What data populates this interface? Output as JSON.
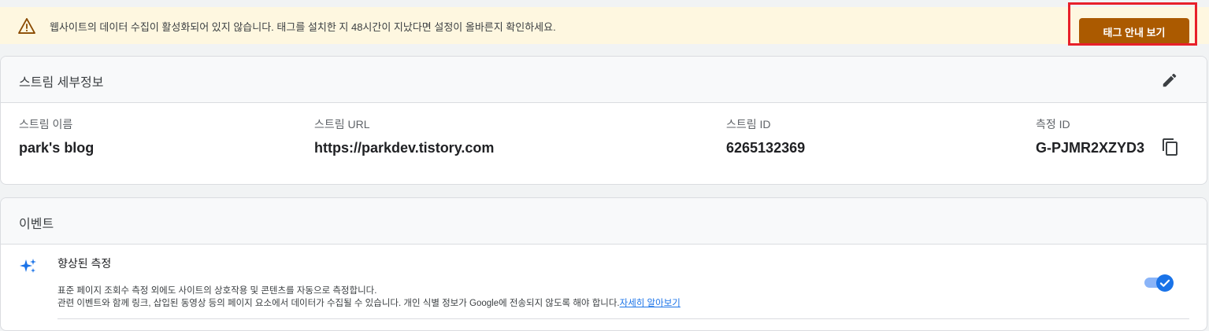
{
  "banner": {
    "message": "웹사이트의 데이터 수집이 활성화되어 있지 않습니다. 태그를 설치한 지 48시간이 지났다면 설정이 올바른지 확인하세요.",
    "button_label": "태그 안내 보기",
    "icon": "warning-icon",
    "accent": "#ab5a00",
    "highlight_color": "#e8202a"
  },
  "stream_details": {
    "title": "스트림 세부정보",
    "fields": [
      {
        "label": "스트림 이름",
        "value": "park's blog"
      },
      {
        "label": "스트림 URL",
        "value": "https://parkdev.tistory.com"
      },
      {
        "label": "스트림 ID",
        "value": "6265132369"
      },
      {
        "label": "측정 ID",
        "value": "G-PJMR2XZYD3"
      }
    ]
  },
  "events": {
    "title": "이벤트",
    "enhanced": {
      "title": "향상된 측정",
      "desc_line1": "표준 페이지 조회수 측정 외에도 사이트의 상호작용 및 콘텐츠를 자동으로 측정합니다.",
      "desc_line2": "관련 이벤트와 함께 링크, 삽입된 동영상 등의 페이지 요소에서 데이터가 수집될 수 있습니다. 개인 식별 정보가 Google에 전송되지 않도록 해야 합니다.",
      "learn_more": "자세히 알아보기",
      "enabled": true
    }
  }
}
